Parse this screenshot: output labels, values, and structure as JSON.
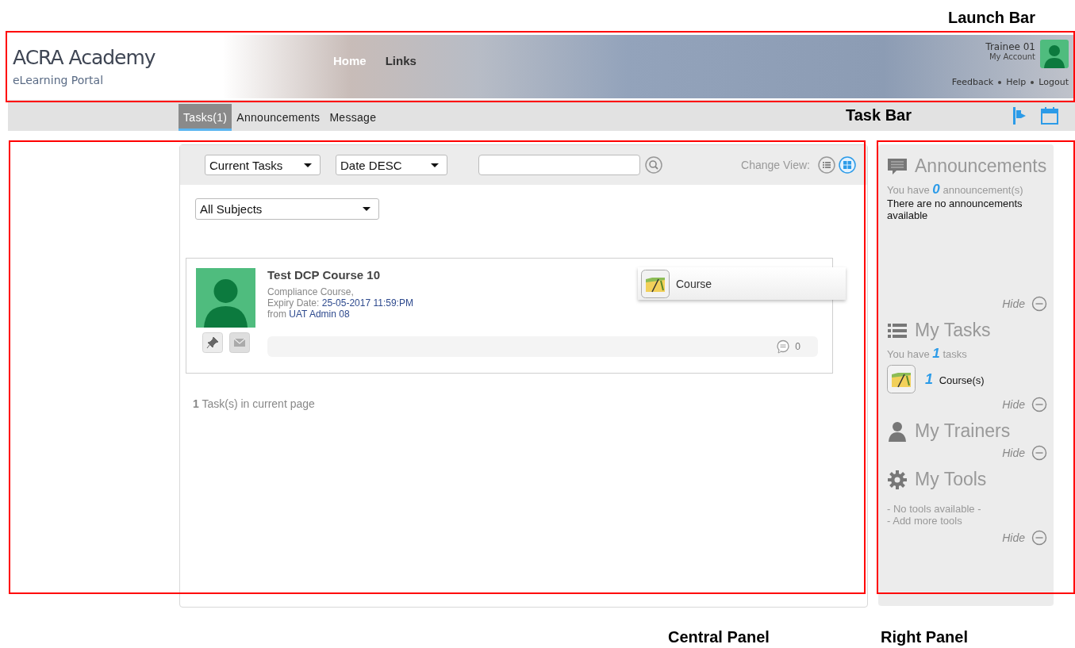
{
  "annotations": [
    {
      "kind": "launch_bar",
      "label": "Launch Bar"
    },
    {
      "kind": "task_bar",
      "label": "Task Bar"
    },
    {
      "kind": "central_panel",
      "label": "Central Panel"
    },
    {
      "kind": "right_panel",
      "label": "Right Panel"
    }
  ],
  "launch_bar": {
    "logo_title": "ACRA Academy",
    "logo_subtitle": "eLearning Portal",
    "nav": [
      {
        "label": "Home",
        "selected": true
      },
      {
        "label": "Links",
        "selected": false
      }
    ],
    "user": {
      "name": "Trainee 01",
      "account_link": "My Account"
    },
    "links": [
      "Feedback",
      "Help",
      "Logout"
    ]
  },
  "task_bar": {
    "tabs": [
      {
        "label": "Tasks(1)",
        "selected": true
      },
      {
        "label": "Announcements",
        "selected": false
      },
      {
        "label": "Message",
        "selected": false
      }
    ]
  },
  "central_panel": {
    "filters": [
      {
        "value": "Current Tasks"
      },
      {
        "value": "Date DESC"
      }
    ],
    "change_view": {
      "label": "Change View:",
      "views": [
        {
          "kind": "list",
          "selected": false
        },
        {
          "kind": "grid",
          "selected": true
        }
      ]
    },
    "subject_filter": {
      "value": "All Subjects"
    },
    "tasks": [
      {
        "title": "Test DCP Course 10",
        "type": "Compliance Course,",
        "expiry_label": "Expiry Date:",
        "expiry": "25-05-2017 11:59:PM",
        "from_label": "from",
        "from": "UAT Admin 08",
        "comments": "0",
        "badge": "Course"
      }
    ],
    "footer": {
      "count": "1",
      "text": "Task(s) in current page"
    }
  },
  "right_panel": {
    "sections": [
      {
        "kind": "announcements",
        "title": "Announcements",
        "pre": "You have",
        "count": "0",
        "post": "announcement(s)",
        "message": "There are no announcements available",
        "hide": "Hide"
      },
      {
        "kind": "tasks",
        "title": "My Tasks",
        "pre": "You have",
        "count": "1",
        "post": "tasks",
        "items": [
          {
            "count": "1",
            "label": "Course(s)"
          }
        ],
        "hide": "Hide"
      },
      {
        "kind": "trainers",
        "title": "My Trainers",
        "hide": "Hide"
      },
      {
        "kind": "tools",
        "title": "My Tools",
        "lines": [
          "- No tools available -",
          "- Add more tools"
        ],
        "hide": "Hide"
      }
    ]
  }
}
